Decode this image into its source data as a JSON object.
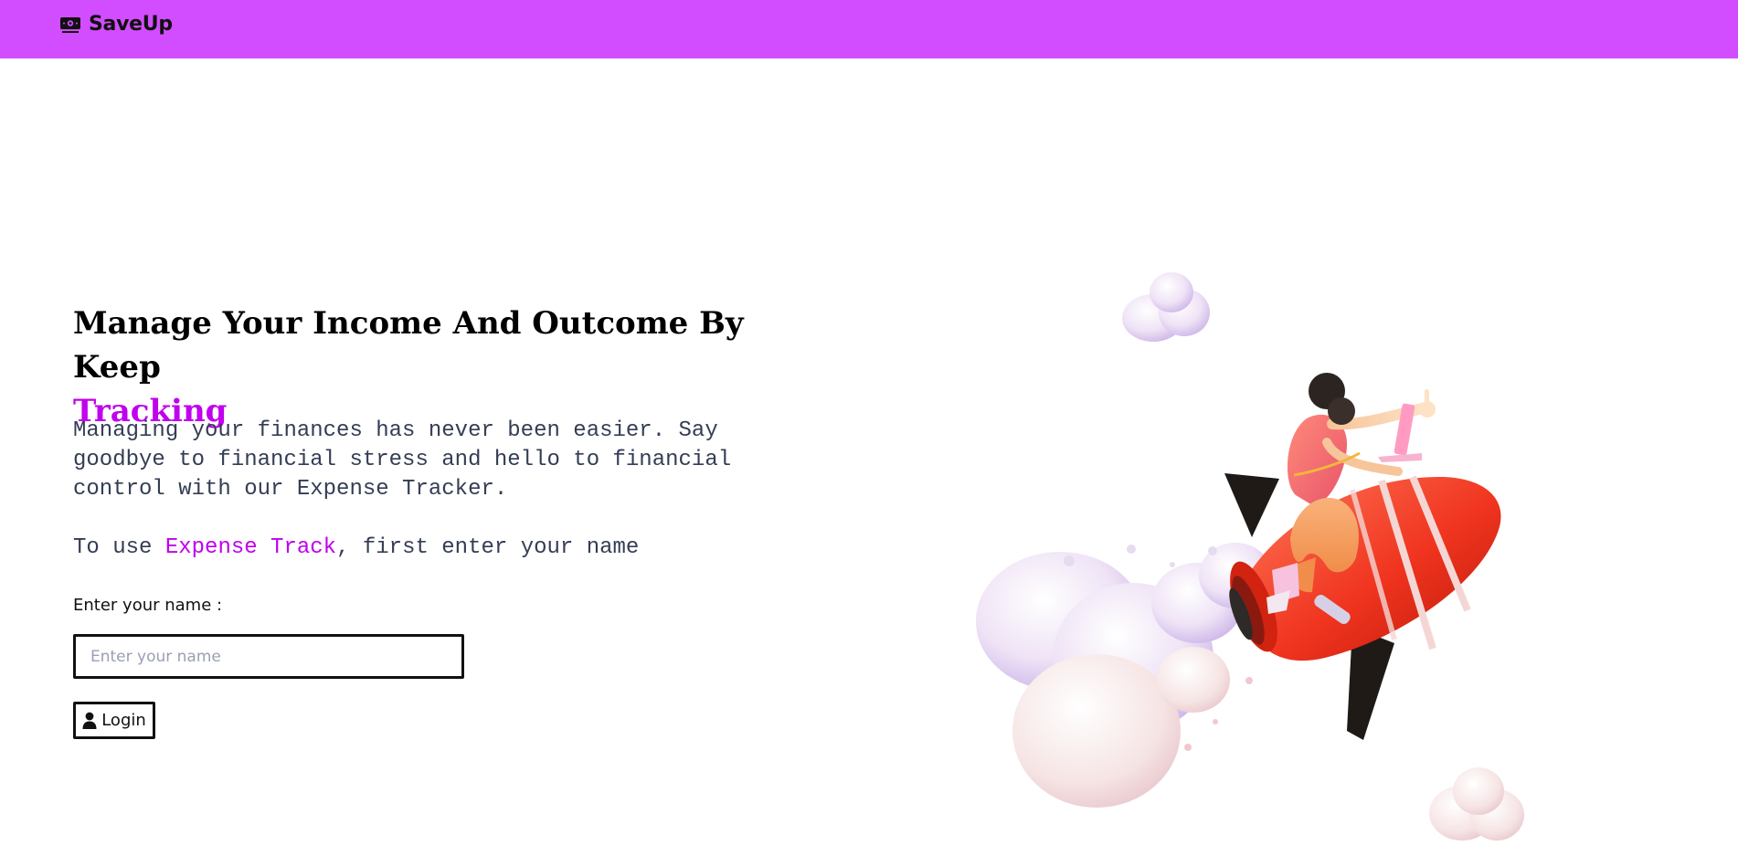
{
  "navbar": {
    "brand_name": "SaveUp",
    "brand_icon": "money-icon",
    "background_color": "#d24dff"
  },
  "hero": {
    "title_main": "Manage Your Income And Outcome By Keep",
    "title_accent": "Tracking",
    "description": "Managing your finances has never been easier. Say goodbye to financial stress and hello to financial control with our Expense Tracker.",
    "hint_prefix": "To use ",
    "hint_accent": "Expense Track",
    "hint_suffix": ", first enter your name",
    "accent_color": "#c000ee"
  },
  "form": {
    "name_label": "Enter your name :",
    "name_placeholder": "Enter your name",
    "name_value": "",
    "login_label": "Login",
    "login_icon": "user-icon"
  },
  "illustration": {
    "icon": "rocket-rider-illustration"
  }
}
